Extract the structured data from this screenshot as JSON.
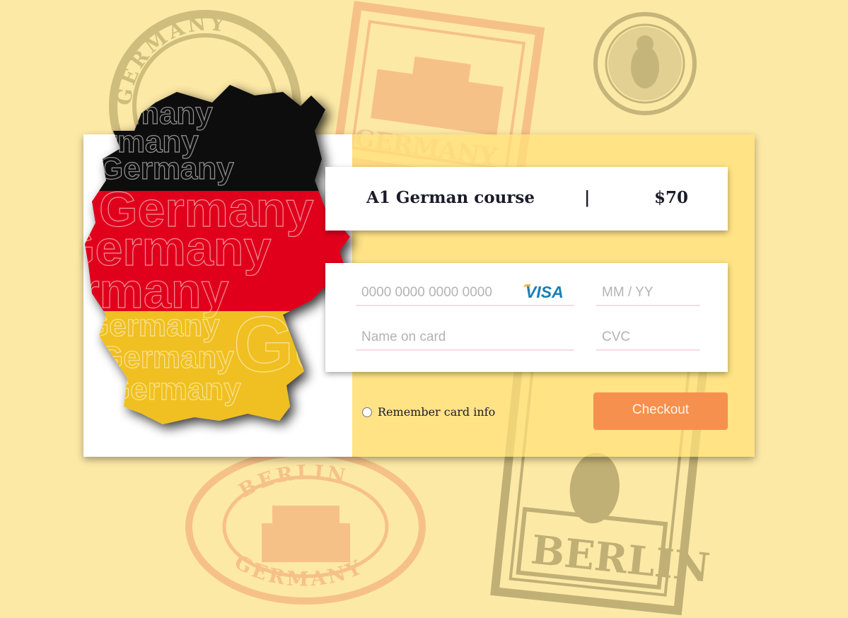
{
  "background": {
    "stamps": [
      "GERMANY",
      "BERLIN",
      "GERMANY",
      "BERLIN",
      "GERMANY"
    ]
  },
  "map": {
    "words": [
      "Germany",
      "Germany",
      "Germany",
      "Germany",
      "Germany",
      "Germany",
      "Germany",
      "Germany",
      "Germany",
      "Germany"
    ],
    "colors": {
      "black": "#0f0f0f",
      "red": "#e1061c",
      "gold": "#f0c020"
    }
  },
  "product": {
    "name": "A1 German course",
    "separator": "|",
    "price": "$70"
  },
  "payment": {
    "card_number_placeholder": "0000 0000 0000 0000",
    "card_brand": "VISA",
    "expiry_placeholder": "MM / YY",
    "name_placeholder": "Name on card",
    "cvc_placeholder": "CVC"
  },
  "remember_label": "Remember card info",
  "checkout_label": "Checkout",
  "colors": {
    "page_bg": "#fde9a6",
    "checkout_bg": "#f6904f",
    "visa": "#1a7fb4",
    "stamp_olive": "#b5a670",
    "stamp_orange": "#f0a37a"
  }
}
